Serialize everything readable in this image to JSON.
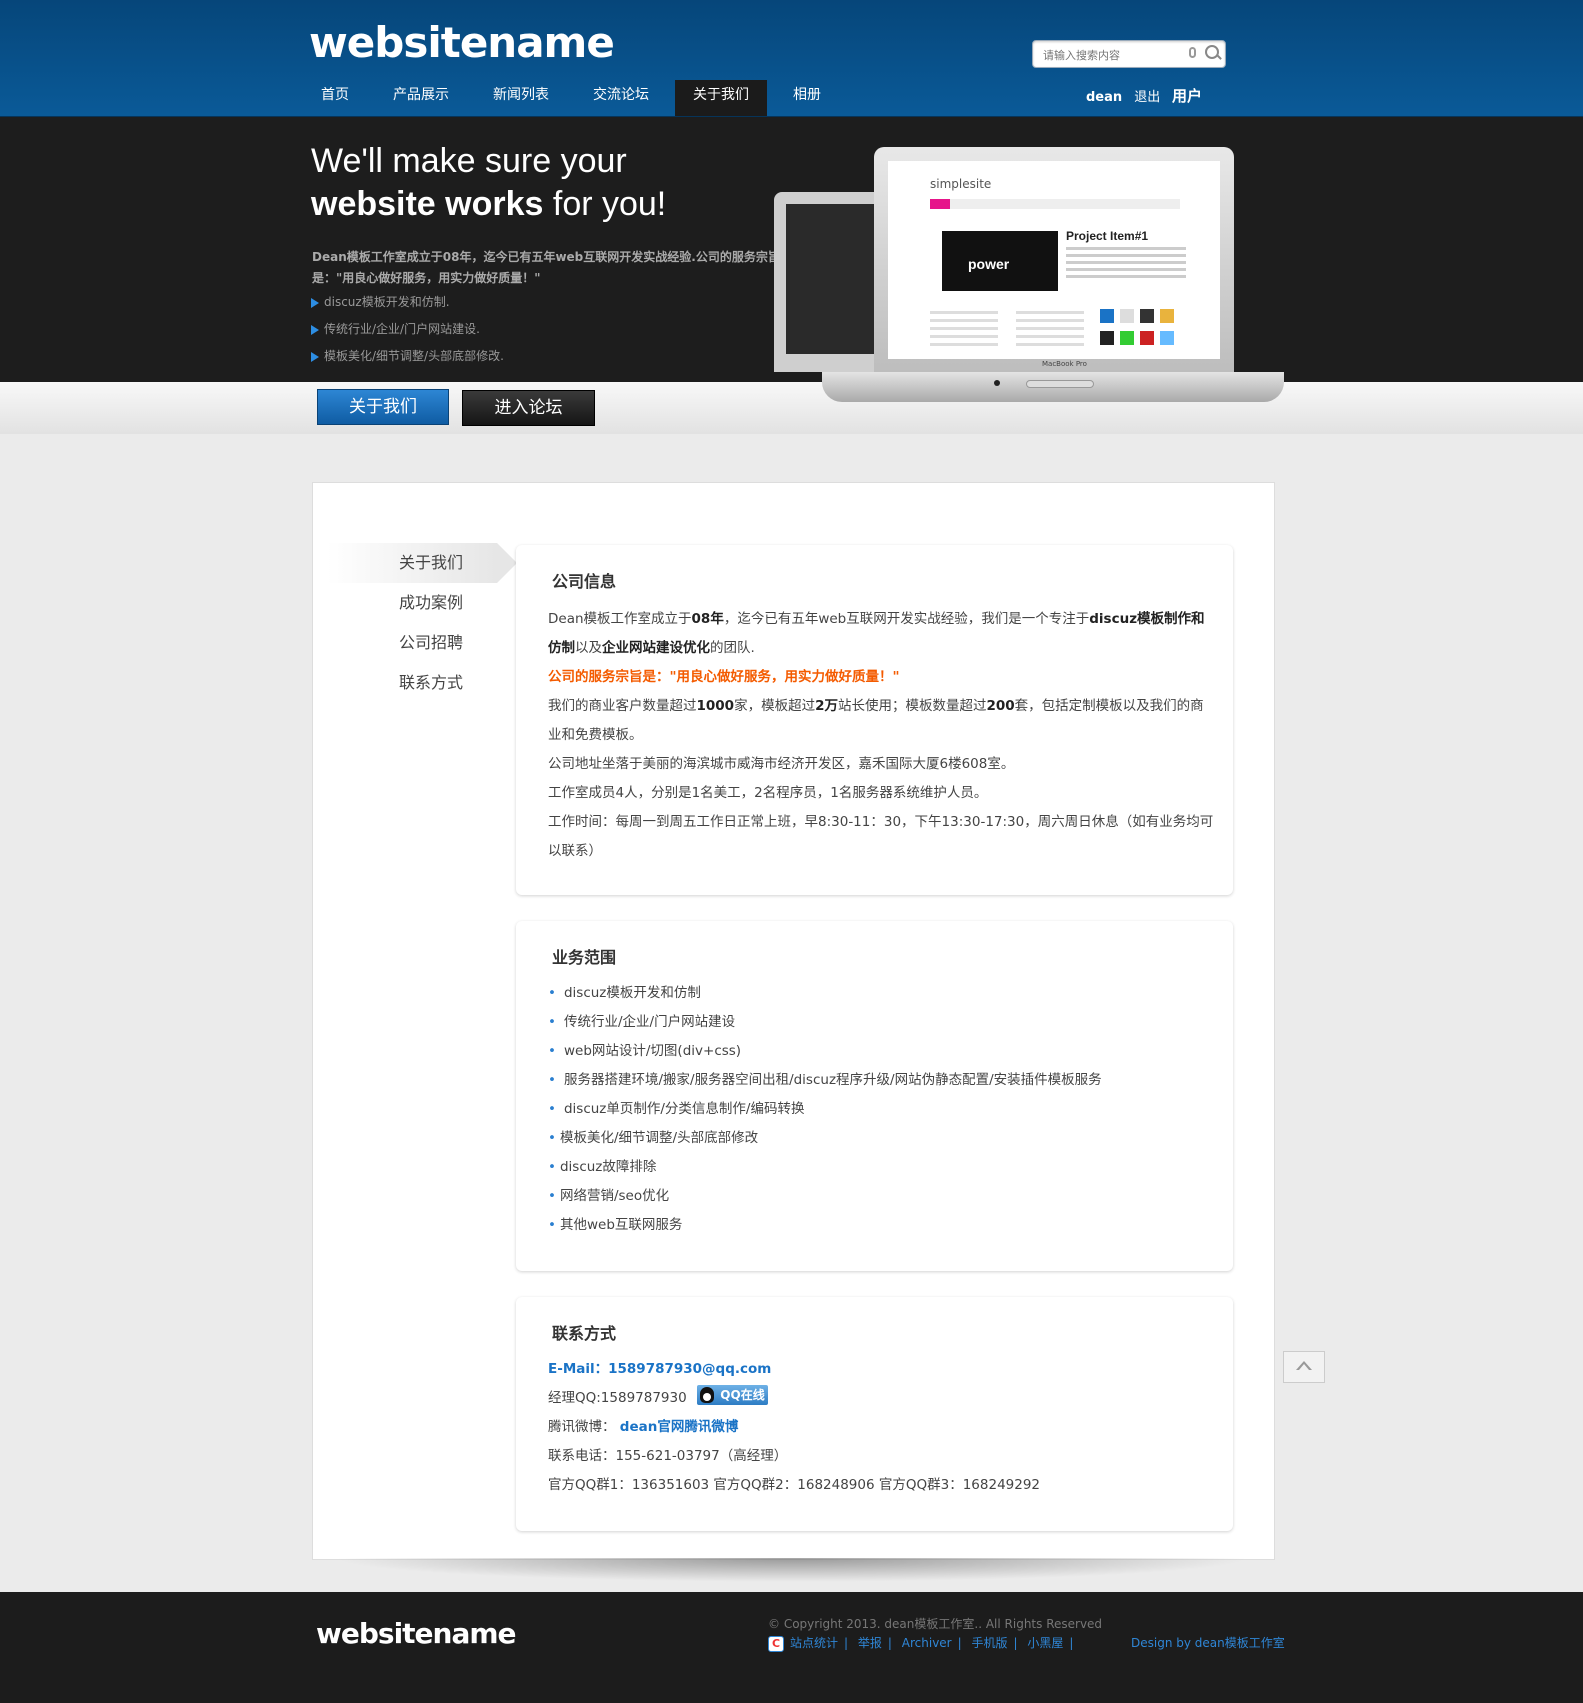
{
  "header": {
    "logo": "websitename",
    "search_placeholder": "请输入搜索内容",
    "nav": [
      "首页",
      "产品展示",
      "新闻列表",
      "交流论坛",
      "关于我们",
      "相册"
    ],
    "active_nav": "关于我们",
    "user_name": "dean",
    "logout": "退出",
    "user_menu": "用户"
  },
  "banner": {
    "headline_1": "We'll make sure your",
    "headline_2_bold": "website works",
    "headline_2_rest": " for you!",
    "intro": "Dean模板工作室成立于08年，迄今已有五年web互联网开发实战经验.公司的服务宗旨是：\"用良心做好服务，用实力做好质量！\"",
    "bullets": [
      "discuz模板开发和仿制.",
      "传统行业/企业/门户网站建设.",
      "模板美化/细节调整/头部底部修改."
    ],
    "btn_about": "关于我们",
    "btn_forum": "进入论坛",
    "laptop": {
      "site_logo": "simplesite",
      "hero_text": "power",
      "project_title": "Project Item#1",
      "caption": "MacBook Pro"
    }
  },
  "sidebar": {
    "items": [
      "关于我们",
      "成功案例",
      "公司招聘",
      "联系方式"
    ]
  },
  "company_info": {
    "title": "公司信息",
    "p1_a": "Dean模板工作室成立于",
    "p1_b": "08年",
    "p1_c": "，迄今已有五年web互联网开发实战经验，我们是一个专注于",
    "p1_d": "discuz模板制作和仿制",
    "p1_e": "以及",
    "p1_f": "企业网站建设优化",
    "p1_g": "的团队.",
    "slogan": "公司的服务宗旨是：\"用良心做好服务，用实力做好质量！\"",
    "p2_a": "我们的商业客户数量超过",
    "p2_b": "1000",
    "p2_c": "家，模板超过",
    "p2_d": "2万",
    "p2_e": "站长使用；模板数量超过",
    "p2_f": "200",
    "p2_g": "套，包括定制模板以及我们的商业和免费模板。",
    "p3": "公司地址坐落于美丽的海滨城市威海市经济开发区，嘉禾国际大厦6楼608室。",
    "p4": "工作室成员4人，分别是1名美工，2名程序员，1名服务器系统维护人员。",
    "p5": "工作时间：每周一到周五工作日正常上班，早8:30-11：30，下午13:30-17:30，周六周日休息（如有业务均可以联系）"
  },
  "business": {
    "title": "业务范围",
    "items": [
      "discuz模板开发和仿制",
      "传统行业/企业/门户网站建设",
      "web网站设计/切图(div+css)",
      "服务器搭建环境/搬家/服务器空间出租/discuz程序升级/网站伪静态配置/安装插件模板服务",
      "discuz单页制作/分类信息制作/编码转换",
      "模板美化/细节调整/头部底部修改",
      "discuz故障排除",
      "网络营销/seo优化",
      "其他web互联网服务"
    ]
  },
  "contact": {
    "title": "联系方式",
    "email": "E-Mail：1589787930@qq.com",
    "qq_label": "经理QQ:1589787930",
    "qq_badge": "QQ在线",
    "weibo_label": "腾讯微博：",
    "weibo_link": "dean官网腾讯微博",
    "phone": "联系电话：155-621-03797（高经理）",
    "groups": "官方QQ群1：136351603 官方QQ群2：168248906 官方QQ群3：168249292"
  },
  "footer": {
    "logo": "websitename",
    "copyright": "© Copyright 2013. dean模板工作室.. All Rights Reserved",
    "links": [
      "站点统计",
      "举报",
      "Archiver",
      "手机版",
      "小黑屋"
    ],
    "design_by": "Design by dean模板工作室"
  },
  "colors": {
    "header_blue": "#0a5a98",
    "banner_dark": "#1d1d1d",
    "link_blue": "#1a73c6",
    "accent_orange": "#f45b00"
  }
}
